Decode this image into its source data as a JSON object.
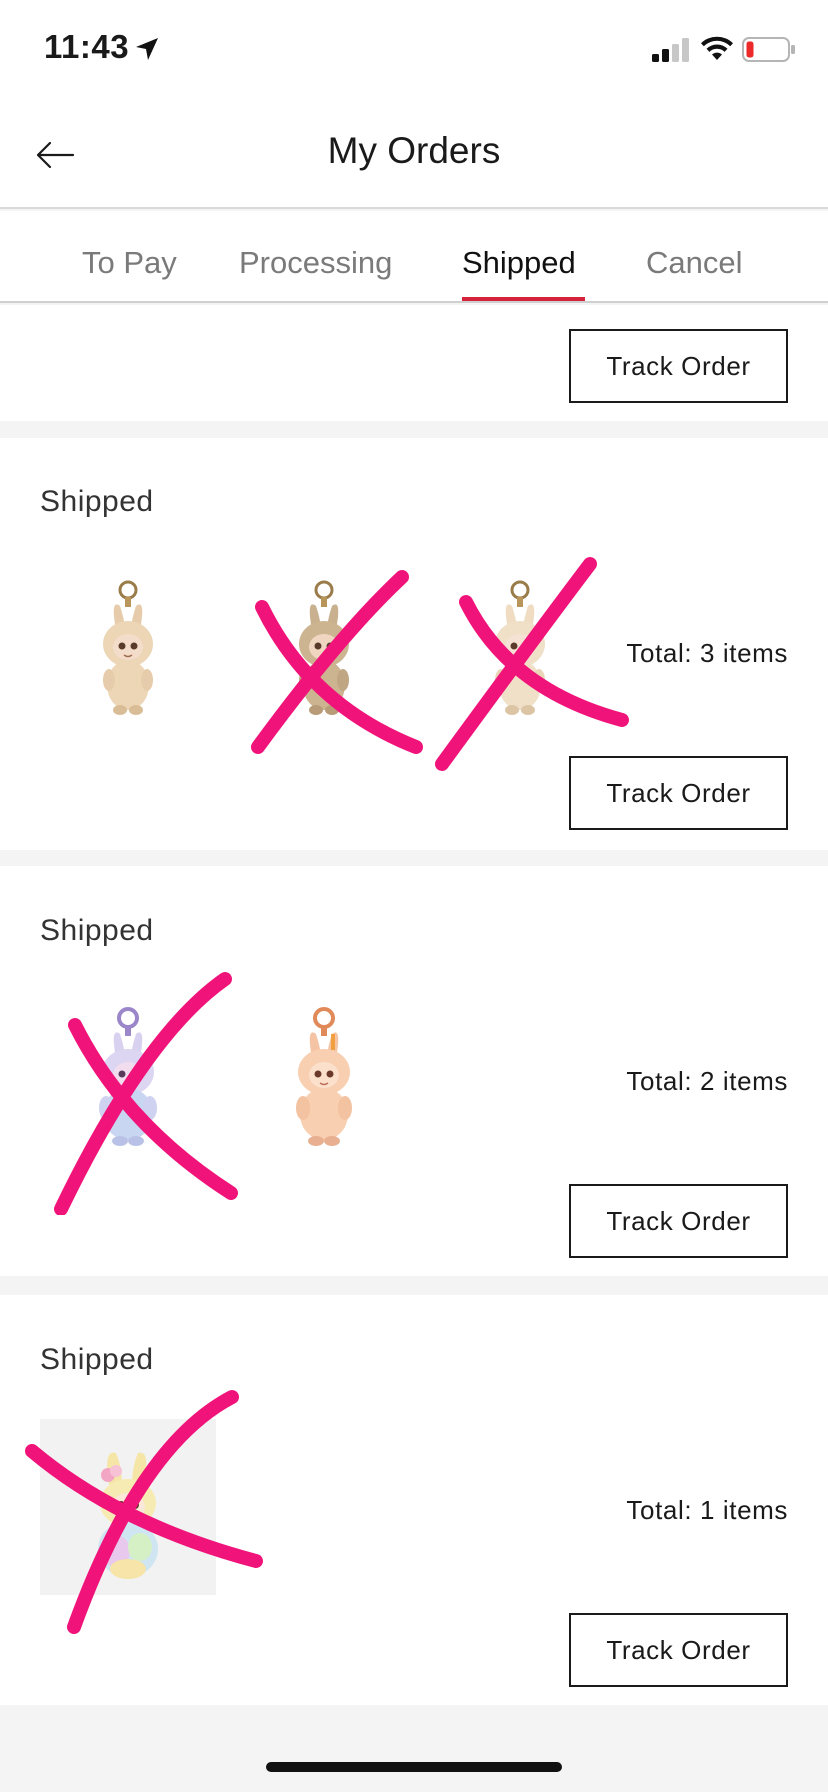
{
  "status_bar": {
    "time": "11:43",
    "icons": [
      "location-arrow-icon",
      "cellular-signal-icon",
      "wifi-icon",
      "battery-low-icon"
    ]
  },
  "nav": {
    "title": "My Orders",
    "back_icon": "arrow-left-icon"
  },
  "tabs": [
    {
      "label": "To Pay",
      "active": false
    },
    {
      "label": "Processing",
      "active": false
    },
    {
      "label": "Shipped",
      "active": true
    },
    {
      "label": "Cancel",
      "active": false
    }
  ],
  "accent_color": "#d4233a",
  "scribble_color": "#f0147a",
  "orders": [
    {
      "status": "",
      "total": "",
      "track_label": "Track Order",
      "items": []
    },
    {
      "status": "Shipped",
      "total": "Total: 3 items",
      "track_label": "Track Order",
      "items": [
        {
          "name": "plush-keychain-beige",
          "crossed_out": false
        },
        {
          "name": "plush-keychain-brown",
          "crossed_out": true
        },
        {
          "name": "plush-keychain-cream",
          "crossed_out": true
        }
      ]
    },
    {
      "status": "Shipped",
      "total": "Total: 2 items",
      "track_label": "Track Order",
      "items": [
        {
          "name": "plush-keychain-lavender",
          "crossed_out": true
        },
        {
          "name": "plush-keychain-peach",
          "crossed_out": false
        }
      ]
    },
    {
      "status": "Shipped",
      "total": "Total: 1 items",
      "track_label": "Track Order",
      "items": [
        {
          "name": "plush-figure-yellow",
          "crossed_out": true
        }
      ]
    }
  ]
}
